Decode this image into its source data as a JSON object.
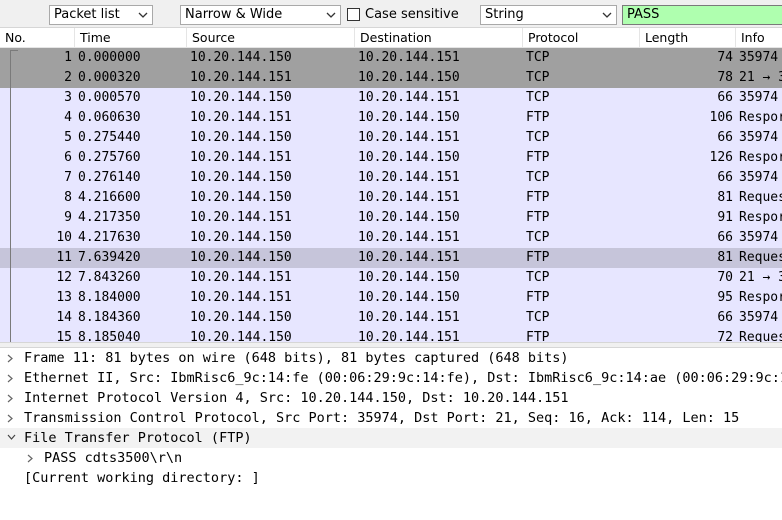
{
  "findbar": {
    "display_combo": "Packet list",
    "charset_combo": "Narrow & Wide",
    "case_sensitive_label": "Case sensitive",
    "type_combo": "String",
    "search_value": "PASS"
  },
  "packet_list": {
    "columns": [
      "No.",
      "Time",
      "Source",
      "Destination",
      "Protocol",
      "Length",
      "Info"
    ],
    "rows": [
      {
        "no": "1",
        "time": "0.000000",
        "src": "10.20.144.150",
        "dst": "10.20.144.151",
        "proto": "TCP",
        "len": "74",
        "info": "35974"
      },
      {
        "no": "2",
        "time": "0.000320",
        "src": "10.20.144.151",
        "dst": "10.20.144.150",
        "proto": "TCP",
        "len": "78",
        "info": "21 → 3"
      },
      {
        "no": "3",
        "time": "0.000570",
        "src": "10.20.144.150",
        "dst": "10.20.144.151",
        "proto": "TCP",
        "len": "66",
        "info": "35974"
      },
      {
        "no": "4",
        "time": "0.060630",
        "src": "10.20.144.151",
        "dst": "10.20.144.150",
        "proto": "FTP",
        "len": "106",
        "info": "Respor"
      },
      {
        "no": "5",
        "time": "0.275440",
        "src": "10.20.144.150",
        "dst": "10.20.144.151",
        "proto": "TCP",
        "len": "66",
        "info": "35974"
      },
      {
        "no": "6",
        "time": "0.275760",
        "src": "10.20.144.151",
        "dst": "10.20.144.150",
        "proto": "FTP",
        "len": "126",
        "info": "Respor"
      },
      {
        "no": "7",
        "time": "0.276140",
        "src": "10.20.144.150",
        "dst": "10.20.144.151",
        "proto": "TCP",
        "len": "66",
        "info": "35974"
      },
      {
        "no": "8",
        "time": "4.216600",
        "src": "10.20.144.150",
        "dst": "10.20.144.151",
        "proto": "FTP",
        "len": "81",
        "info": "Reques"
      },
      {
        "no": "9",
        "time": "4.217350",
        "src": "10.20.144.151",
        "dst": "10.20.144.150",
        "proto": "FTP",
        "len": "91",
        "info": "Respor"
      },
      {
        "no": "10",
        "time": "4.217630",
        "src": "10.20.144.150",
        "dst": "10.20.144.151",
        "proto": "TCP",
        "len": "66",
        "info": "35974"
      },
      {
        "no": "11",
        "time": "7.639420",
        "src": "10.20.144.150",
        "dst": "10.20.144.151",
        "proto": "FTP",
        "len": "81",
        "info": "Reques"
      },
      {
        "no": "12",
        "time": "7.843260",
        "src": "10.20.144.151",
        "dst": "10.20.144.150",
        "proto": "TCP",
        "len": "70",
        "info": "21 → 3"
      },
      {
        "no": "13",
        "time": "8.184000",
        "src": "10.20.144.151",
        "dst": "10.20.144.150",
        "proto": "FTP",
        "len": "95",
        "info": "Respor"
      },
      {
        "no": "14",
        "time": "8.184360",
        "src": "10.20.144.150",
        "dst": "10.20.144.151",
        "proto": "TCP",
        "len": "66",
        "info": "35974"
      },
      {
        "no": "15",
        "time": "8.185040",
        "src": "10.20.144.150",
        "dst": "10.20.144.151",
        "proto": "FTP",
        "len": "72",
        "info": "Reques"
      }
    ]
  },
  "details": {
    "items": [
      "Frame 11: 81 bytes on wire (648 bits), 81 bytes captured (648 bits)",
      "Ethernet II, Src: IbmRisc6_9c:14:fe (00:06:29:9c:14:fe), Dst: IbmRisc6_9c:14:ae (00:06:29:9c:14",
      "Internet Protocol Version 4, Src: 10.20.144.150, Dst: 10.20.144.151",
      "Transmission Control Protocol, Src Port: 35974, Dst Port: 21, Seq: 16, Ack: 114, Len: 15",
      "File Transfer Protocol (FTP)",
      "PASS cdts3500\\r\\n",
      "[Current working directory: ]"
    ]
  },
  "colors": {
    "row_default": "#e7e6ff",
    "row_dark": "#a0a0a0",
    "row_selected": "#c6c5da",
    "search_bg": "#afffaf"
  }
}
